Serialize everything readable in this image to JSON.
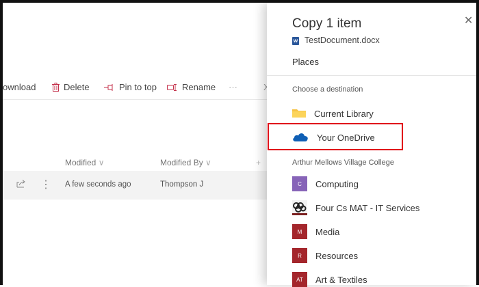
{
  "toolbar": {
    "download": "ownload",
    "delete": "Delete",
    "pin": "Pin to top",
    "rename": "Rename",
    "more": "···",
    "x_partial": "X"
  },
  "list": {
    "col_modified": "Modified",
    "col_modified_by": "Modified By",
    "add_col": "+",
    "row": {
      "modified": "A few seconds ago",
      "modified_by": "Thompson J"
    }
  },
  "panel": {
    "title": "Copy 1 item",
    "file_name": "TestDocument.docx",
    "places": "Places",
    "choose": "Choose a destination",
    "current_library": "Current Library",
    "your_onedrive": "Your OneDrive",
    "group": "Arthur Mellows Village College",
    "sites": [
      {
        "label": "Computing",
        "badge": "C",
        "color": "#8764b8"
      },
      {
        "label": "Four Cs MAT - IT Services",
        "badge": "",
        "color": "#7a1f1f"
      },
      {
        "label": "Media",
        "badge": "M",
        "color": "#a4262c"
      },
      {
        "label": "Resources",
        "badge": "R",
        "color": "#a4262c"
      },
      {
        "label": "Art & Textiles",
        "badge": "AT",
        "color": "#a4262c"
      }
    ]
  },
  "colors": {
    "highlight": "#e0121a",
    "folder": "#f6c243",
    "onedrive": "#0f5fb5"
  }
}
